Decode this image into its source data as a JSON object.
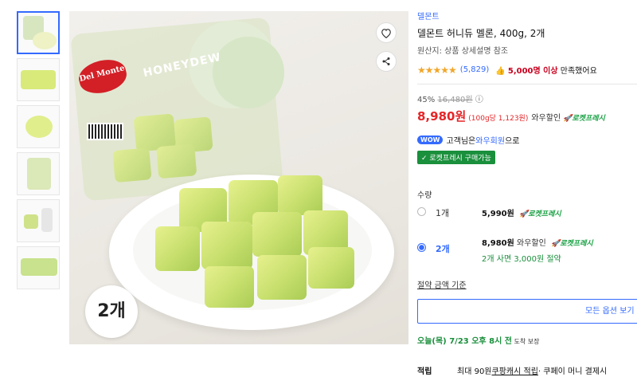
{
  "product": {
    "brand": "델몬트",
    "title": "델몬트 허니듀 멜론, 400g, 2개",
    "origin": "원산지: 상품 상세설명 참조",
    "rating_stars": "★★★★★",
    "review_count": "(5,829)",
    "satisfaction_prefix": "👍 ",
    "satisfaction_count": "5,000명 이상",
    "satisfaction_suffix": " 만족했어요",
    "logo_text": "Del Monte",
    "image_label": "HONEYDEW",
    "quantity_badge": "2개"
  },
  "pricing": {
    "discount_rate": "45%",
    "original_price": "16,480원",
    "info_icon": "ⓘ",
    "price": "8,980원",
    "unit_price": "(100g당 1,123원)",
    "wow_discount": "와우할인",
    "rocket_label": "로켓프레시"
  },
  "membership": {
    "wow_badge": "WOW",
    "text_before": "고객님은 ",
    "link_text": "와우회원",
    "text_after": "으로",
    "fresh_badge": "✓ 로켓프레시 구매가능"
  },
  "quantity": {
    "label": "수량",
    "options": [
      {
        "name": "1개",
        "price": "5,990원",
        "extra": "",
        "rocket": "로켓프레시",
        "savings": "",
        "selected": false
      },
      {
        "name": "2개",
        "price": "8,980원",
        "extra": "와우할인",
        "rocket": "로켓프레시",
        "savings": "2개 사면 3,000원 절약",
        "selected": true
      }
    ]
  },
  "unit_price_link": "절약 금액 기준",
  "all_options_button": "모든 옵션 보기",
  "delivery": {
    "text": "오늘(목) 7/23 오후 8시 전",
    "suffix": " 도착 보장"
  },
  "points": {
    "label": "적립",
    "text": "최대 90원 ",
    "link": "쿠팡캐시 적립",
    "rest": " · 쿠페이 머니 결제시"
  },
  "icons": {
    "heart": "heart-icon",
    "share": "share-icon",
    "star": "star-icon",
    "check": "check-icon"
  },
  "colors": {
    "accent": "#346aff",
    "price": "#e52528",
    "rocket": "#1aa144",
    "star": "#f1a62a"
  }
}
